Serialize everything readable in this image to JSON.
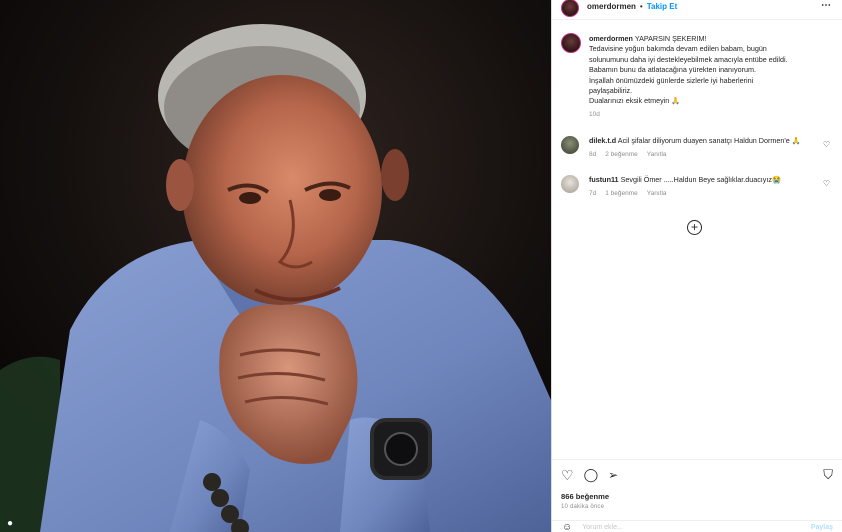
{
  "header": {
    "username": "omerdormen",
    "separator": "•",
    "follow_label": "Takip Et",
    "more_icon": "⋯"
  },
  "caption": {
    "username": "omerdormen",
    "lines": [
      "YAPARSIN ŞEKERIM!",
      "Tedavisine yoğun bakımda devam edilen babam, bugün",
      "solunumunu daha iyi destekleyebilmek amacıyla entübe edildi.",
      "Babamın bunu da atlatacağına yürekten inanıyorum.",
      "İnşallah önümüzdeki günlerde sizlerle iyi haberlerini",
      "paylaşabiliriz.",
      "Dualarınızı eksik etmeyin 🙏"
    ],
    "time": "10d"
  },
  "comments": [
    {
      "username": "dilek.t.d",
      "text": "Acil şifalar diliyorum duayen sanatçı Haldun Dormen'e 🙏",
      "time": "8d",
      "likes": "2 beğenme",
      "reply": "Yanıtla"
    },
    {
      "username": "fustun11",
      "text": "Sevgili Ömer .....Haldun Beye sağlıklar.duacıyız😭",
      "time": "7d",
      "likes": "1 beğenme",
      "reply": "Yanıtla"
    }
  ],
  "more_comments_icon": "⊕",
  "actions": {
    "like_icon": "♡",
    "comment_icon": "◯",
    "share_icon": "➢",
    "save_icon": "🔖",
    "likes": "866 beğenme",
    "time_ago": "10 dakika önce"
  },
  "add_comment": {
    "emoji_icon": "☺",
    "placeholder": "Yorum ekle...",
    "share_label": "Paylaş"
  },
  "colors": {
    "accent": "#0095f6",
    "text": "#262626",
    "muted": "#8e8e8e",
    "border": "#efefef",
    "photo_sweater": "#7b92c8"
  }
}
